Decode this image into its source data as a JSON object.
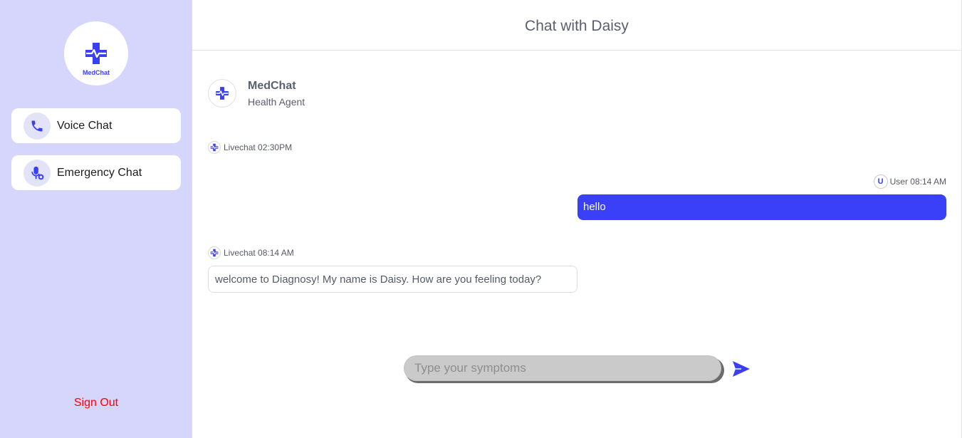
{
  "sidebar": {
    "logo_text": "MedChat",
    "nav": [
      {
        "label": "Voice Chat",
        "icon": "phone-icon"
      },
      {
        "label": "Emergency Chat",
        "icon": "microphone-icon"
      }
    ],
    "sign_out": "Sign Out"
  },
  "header": {
    "title": "Chat with Daisy"
  },
  "agent": {
    "name": "MedChat",
    "role": "Health Agent"
  },
  "messages": [
    {
      "sender": "Livechat",
      "time": "02:30PM",
      "text": ""
    },
    {
      "sender": "User",
      "badge": "U",
      "time": "08:14 AM",
      "text": "hello"
    },
    {
      "sender": "Livechat",
      "time": "08:14 AM",
      "text": "welcome to Diagnosy! My name is Daisy. How are you feeling today?"
    }
  ],
  "input": {
    "placeholder": "Type your symptoms",
    "value": ""
  },
  "colors": {
    "sidebar_bg": "#d6d6fd",
    "accent": "#3a3ff8",
    "sign_out": "#ff0000"
  }
}
